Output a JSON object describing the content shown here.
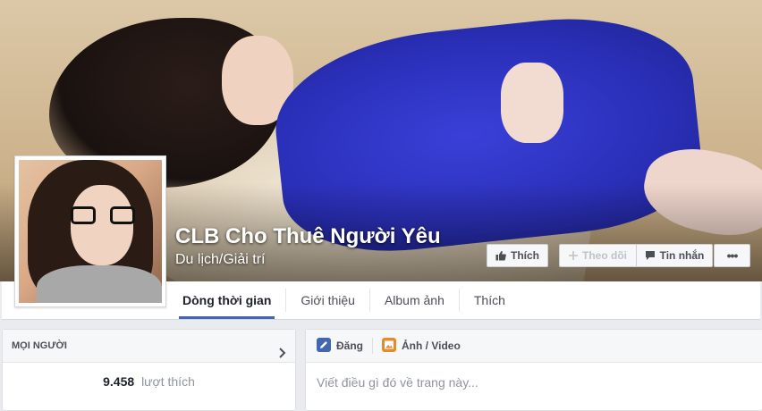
{
  "page": {
    "name": "CLB Cho Thuê Người Yêu",
    "category": "Du lịch/Giải trí"
  },
  "tabs": [
    {
      "label": "Dòng thời gian"
    },
    {
      "label": "Giới thiệu"
    },
    {
      "label": "Album ảnh"
    },
    {
      "label": "Thích"
    }
  ],
  "actions": {
    "like_label": "Thích",
    "follow_label": "Theo dõi",
    "message_label": "Tin nhắn",
    "more_label": "•••"
  },
  "people_panel": {
    "title": "MỌI NGƯỜI",
    "like_count": "9.458",
    "like_label": "lượt thích"
  },
  "composer": {
    "post_tab": "Đăng",
    "photo_tab": "Ảnh / Video",
    "placeholder": "Viết điều gì đó về trang này..."
  },
  "icons": {
    "like": "thumbs-up-icon",
    "follow": "plus-icon",
    "message": "message-icon",
    "post": "pencil-icon",
    "photo": "photo-icon",
    "chevron": "chevron-right-icon"
  },
  "colors": {
    "accent": "#4267b2",
    "background": "#e9ebee",
    "text_muted": "#90949c"
  }
}
